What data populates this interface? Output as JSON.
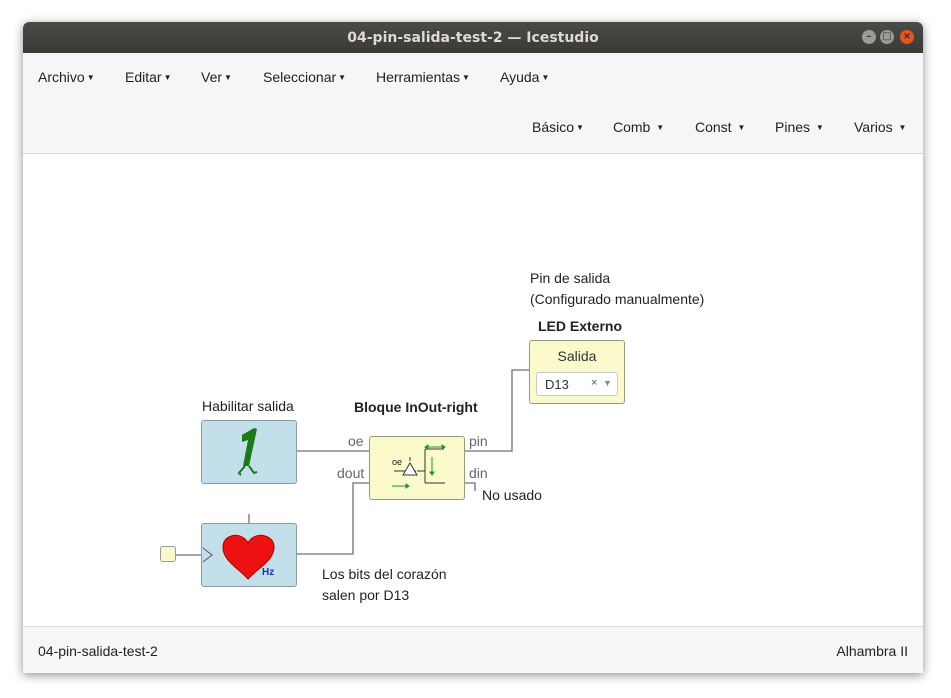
{
  "window": {
    "title": "04-pin-salida-test-2 — Icestudio"
  },
  "menubar": {
    "main": [
      "Archivo",
      "Editar",
      "Ver",
      "Seleccionar",
      "Herramientas",
      "Ayuda"
    ],
    "blocks": [
      "Básico",
      "Comb",
      "Const",
      "Pines",
      "Varios"
    ]
  },
  "canvas": {
    "output_pin": {
      "comment_line1": "Pin de salida",
      "comment_line2": "(Configurado manualmente)",
      "title": "LED Externo",
      "label": "Salida",
      "selected_pin": "D13",
      "clear_symbol": "×"
    },
    "enable_block": {
      "label": "Habilitar salida",
      "icon": "constant-1-icon"
    },
    "inout_block": {
      "title": "Bloque InOut-right",
      "port_oe": "oe",
      "port_dout": "dout",
      "port_pin": "pin",
      "port_din": "din",
      "inner_label": "oe",
      "icon": "tristate-buffer-icon"
    },
    "din_note": "No usado",
    "heart_block": {
      "icon": "heart-icon",
      "unit": "Hz"
    },
    "heart_note_line1": "Los bits del corazón",
    "heart_note_line2": "salen por D13"
  },
  "statusbar": {
    "project": "04-pin-salida-test-2",
    "board": "Alhambra II"
  },
  "colors": {
    "titlebar": "#3c3b37",
    "block_blue": "#c3dfe9",
    "block_yellow": "#fbfacd",
    "heart_red": "#ee1111",
    "close_button": "#e9561d"
  }
}
